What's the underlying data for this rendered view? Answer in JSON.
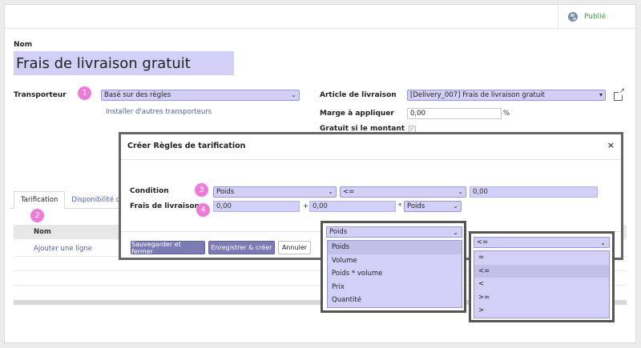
{
  "header": {
    "status_label": "Publié"
  },
  "form": {
    "name_label": "Nom",
    "name_value": "Frais de livraison gratuit",
    "carrier_label": "Transporteur",
    "carrier_value": "Basé sur des règles",
    "install_link": "Installer d'autres transporteurs",
    "delivery_product_label": "Article de livraison",
    "delivery_product_value": "[Delivery_007] Frais de livraison gratuit",
    "margin_label": "Marge à appliquer",
    "margin_value": "0,00",
    "margin_unit": "%",
    "free_label": "Gratuit si le montant",
    "free_checkmark": "✓"
  },
  "badges": [
    "1",
    "2",
    "3",
    "4"
  ],
  "tabs": [
    {
      "label": "Tarification"
    },
    {
      "label": "Disponibilité de"
    }
  ],
  "table": {
    "col_name": "Nom",
    "add_line": "Ajouter une ligne"
  },
  "modal": {
    "title": "Créer Règles de tarification",
    "close": "×",
    "condition_label": "Condition",
    "condition_variable": "Poids",
    "condition_operator": "<=",
    "condition_value": "0,00",
    "price_label": "Frais de livraison",
    "price_base": "0,00",
    "plus_sign": "+",
    "price_factor": "0,00",
    "times_sign": "*",
    "price_variable": "Poids",
    "save_close": "Sauvegarder et fermer",
    "save_new": "Enregistrer & créer",
    "cancel": "Annuler"
  },
  "variable_dropdown": {
    "selected": "Poids",
    "options": [
      "Poids",
      "Volume",
      "Poids * volume",
      "Prix",
      "Quantité"
    ]
  },
  "operator_dropdown": {
    "selected": "<=",
    "options": [
      "=",
      "<=",
      "<",
      ">=",
      ">"
    ]
  }
}
